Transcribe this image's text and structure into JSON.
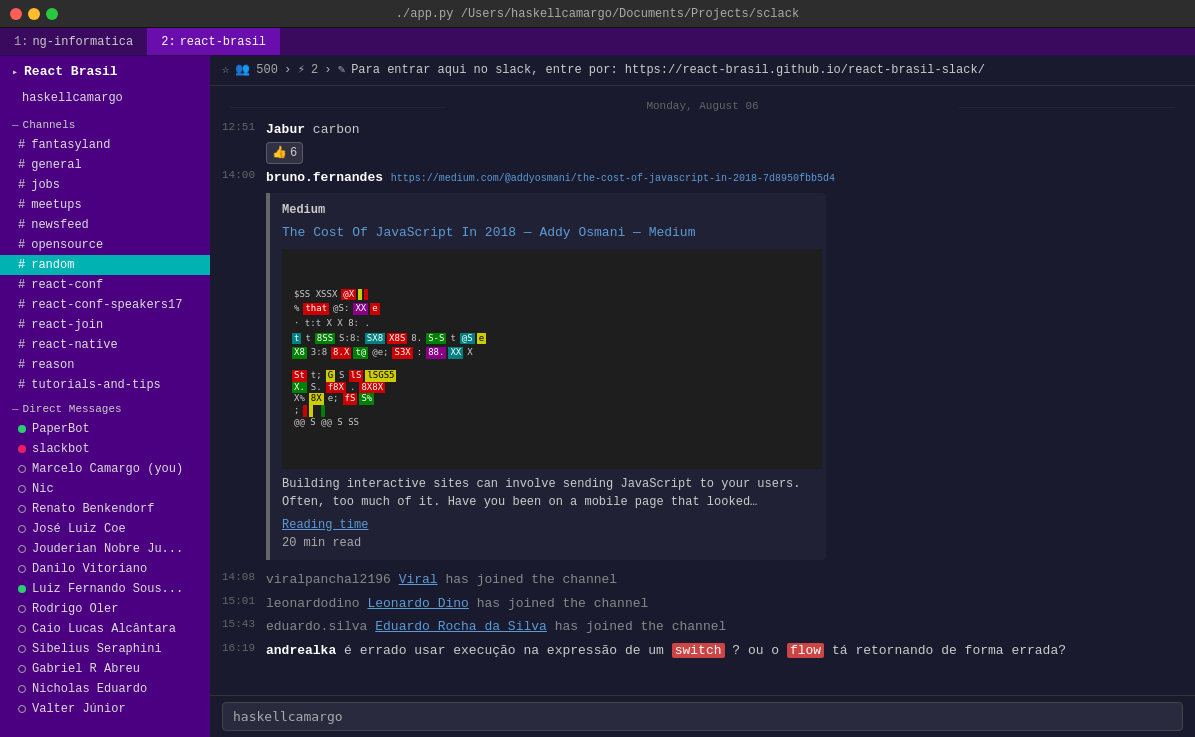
{
  "titlebar": {
    "title": "./app.py  /Users/haskellcamargo/Documents/Projects/sclack"
  },
  "tabs": [
    {
      "id": "tab1",
      "num": "1:",
      "label": "ng-informatica",
      "active": false,
      "badge": null
    },
    {
      "id": "tab2",
      "num": "2:",
      "label": "react-brasil",
      "active": true,
      "badge": null
    }
  ],
  "sidebar": {
    "workspace": "React Brasil",
    "user": "haskellcamargo",
    "channels_label": "Channels",
    "channels": [
      {
        "name": "fantasyland",
        "active": false
      },
      {
        "name": "general",
        "active": false
      },
      {
        "name": "jobs",
        "active": false
      },
      {
        "name": "meetups",
        "active": false
      },
      {
        "name": "newsfeed",
        "active": false
      },
      {
        "name": "opensource",
        "active": false
      },
      {
        "name": "random",
        "active": true
      },
      {
        "name": "react-conf",
        "active": false
      },
      {
        "name": "react-conf-speakers17",
        "active": false
      },
      {
        "name": "react-join",
        "active": false
      },
      {
        "name": "react-native",
        "active": false
      },
      {
        "name": "reason",
        "active": false
      },
      {
        "name": "tutorials-and-tips",
        "active": false
      }
    ],
    "dm_label": "Direct Messages",
    "dms": [
      {
        "name": "PaperBot",
        "status": "online"
      },
      {
        "name": "slackbot",
        "status": "away"
      },
      {
        "name": "Marcelo Camargo (you)",
        "status": "offline"
      },
      {
        "name": "Nic",
        "status": "offline"
      },
      {
        "name": "Renato Benkendorf",
        "status": "offline"
      },
      {
        "name": "José Luiz Coe",
        "status": "offline"
      },
      {
        "name": "Jouderian Nobre Ju...",
        "status": "offline"
      },
      {
        "name": "Danilo Vitoriano",
        "status": "offline"
      },
      {
        "name": "Luiz Fernando Sous...",
        "status": "online"
      },
      {
        "name": "Rodrigo Oler",
        "status": "offline"
      },
      {
        "name": "Caio Lucas Alcântara",
        "status": "offline"
      },
      {
        "name": "Sibelius Seraphini",
        "status": "offline"
      },
      {
        "name": "Gabriel R Abreu",
        "status": "offline"
      },
      {
        "name": "Nicholas Eduardo",
        "status": "offline"
      },
      {
        "name": "Valter Júnior",
        "status": "offline"
      }
    ]
  },
  "channel": {
    "star_icon": "☆",
    "name": "random",
    "members": "500",
    "integrations": "2",
    "pencil_icon": "✎",
    "topic": "Para entrar aqui no slack, entre por: https://react-brasil.github.io/react-brasil-slack/",
    "date_divider": "Monday, August 06"
  },
  "messages": [
    {
      "time": "12:51",
      "author": "Jabur",
      "text": "carbon",
      "reaction": "👍 6",
      "has_reaction": true
    },
    {
      "time": "14:00",
      "author": "bruno.fernandes",
      "link": "https://medium.com/@addyosmani/the-cost-of-javascript-in-2018-7d8950fbb5d4",
      "preview_source": "Medium",
      "preview_title": "The Cost Of JavaScript In 2018 — Addy Osmani — Medium",
      "preview_desc": "Building interactive sites can involve sending JavaScript to your users. Often, too much of it. Have you been on a mobile page that looked…",
      "preview_readtime_label": "Reading time",
      "preview_readtime": "20 min read"
    },
    {
      "time": "14:08",
      "join_user": "Viral",
      "join_full": "viralpanchal2196",
      "join_text": "has joined the channel"
    },
    {
      "time": "15:01",
      "join_user": "Leonardo Dino",
      "join_full": "leonardodino",
      "join_text": "has joined the channel"
    },
    {
      "time": "15:43",
      "join_user": "Eduardo Rocha da Silva",
      "join_full": "eduardo.silva",
      "join_text": "has joined the channel"
    },
    {
      "time": "16:19",
      "author": "andrealka",
      "text_before": "é errado usar execução na expressão de um",
      "highlight1": "switch",
      "text_middle": "? ou o",
      "highlight2": "flow",
      "text_after": "tá retornando de forma errada?"
    }
  ],
  "input": {
    "placeholder": "haskellcamargo"
  }
}
